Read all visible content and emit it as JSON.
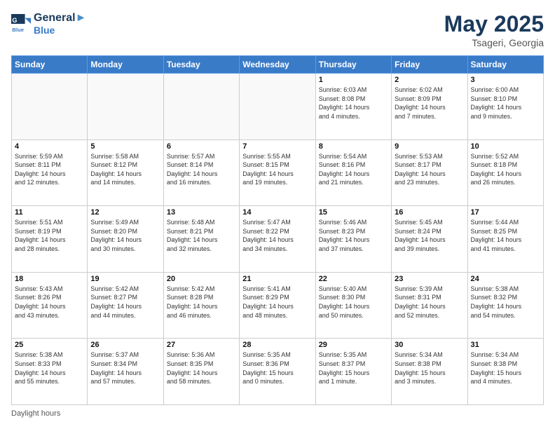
{
  "header": {
    "logo_line1": "General",
    "logo_line2": "Blue",
    "month_title": "May 2025",
    "location": "Tsageri, Georgia"
  },
  "footer": {
    "label": "Daylight hours"
  },
  "days_of_week": [
    "Sunday",
    "Monday",
    "Tuesday",
    "Wednesday",
    "Thursday",
    "Friday",
    "Saturday"
  ],
  "weeks": [
    [
      {
        "num": "",
        "info": ""
      },
      {
        "num": "",
        "info": ""
      },
      {
        "num": "",
        "info": ""
      },
      {
        "num": "",
        "info": ""
      },
      {
        "num": "1",
        "info": "Sunrise: 6:03 AM\nSunset: 8:08 PM\nDaylight: 14 hours\nand 4 minutes."
      },
      {
        "num": "2",
        "info": "Sunrise: 6:02 AM\nSunset: 8:09 PM\nDaylight: 14 hours\nand 7 minutes."
      },
      {
        "num": "3",
        "info": "Sunrise: 6:00 AM\nSunset: 8:10 PM\nDaylight: 14 hours\nand 9 minutes."
      }
    ],
    [
      {
        "num": "4",
        "info": "Sunrise: 5:59 AM\nSunset: 8:11 PM\nDaylight: 14 hours\nand 12 minutes."
      },
      {
        "num": "5",
        "info": "Sunrise: 5:58 AM\nSunset: 8:12 PM\nDaylight: 14 hours\nand 14 minutes."
      },
      {
        "num": "6",
        "info": "Sunrise: 5:57 AM\nSunset: 8:14 PM\nDaylight: 14 hours\nand 16 minutes."
      },
      {
        "num": "7",
        "info": "Sunrise: 5:55 AM\nSunset: 8:15 PM\nDaylight: 14 hours\nand 19 minutes."
      },
      {
        "num": "8",
        "info": "Sunrise: 5:54 AM\nSunset: 8:16 PM\nDaylight: 14 hours\nand 21 minutes."
      },
      {
        "num": "9",
        "info": "Sunrise: 5:53 AM\nSunset: 8:17 PM\nDaylight: 14 hours\nand 23 minutes."
      },
      {
        "num": "10",
        "info": "Sunrise: 5:52 AM\nSunset: 8:18 PM\nDaylight: 14 hours\nand 26 minutes."
      }
    ],
    [
      {
        "num": "11",
        "info": "Sunrise: 5:51 AM\nSunset: 8:19 PM\nDaylight: 14 hours\nand 28 minutes."
      },
      {
        "num": "12",
        "info": "Sunrise: 5:49 AM\nSunset: 8:20 PM\nDaylight: 14 hours\nand 30 minutes."
      },
      {
        "num": "13",
        "info": "Sunrise: 5:48 AM\nSunset: 8:21 PM\nDaylight: 14 hours\nand 32 minutes."
      },
      {
        "num": "14",
        "info": "Sunrise: 5:47 AM\nSunset: 8:22 PM\nDaylight: 14 hours\nand 34 minutes."
      },
      {
        "num": "15",
        "info": "Sunrise: 5:46 AM\nSunset: 8:23 PM\nDaylight: 14 hours\nand 37 minutes."
      },
      {
        "num": "16",
        "info": "Sunrise: 5:45 AM\nSunset: 8:24 PM\nDaylight: 14 hours\nand 39 minutes."
      },
      {
        "num": "17",
        "info": "Sunrise: 5:44 AM\nSunset: 8:25 PM\nDaylight: 14 hours\nand 41 minutes."
      }
    ],
    [
      {
        "num": "18",
        "info": "Sunrise: 5:43 AM\nSunset: 8:26 PM\nDaylight: 14 hours\nand 43 minutes."
      },
      {
        "num": "19",
        "info": "Sunrise: 5:42 AM\nSunset: 8:27 PM\nDaylight: 14 hours\nand 44 minutes."
      },
      {
        "num": "20",
        "info": "Sunrise: 5:42 AM\nSunset: 8:28 PM\nDaylight: 14 hours\nand 46 minutes."
      },
      {
        "num": "21",
        "info": "Sunrise: 5:41 AM\nSunset: 8:29 PM\nDaylight: 14 hours\nand 48 minutes."
      },
      {
        "num": "22",
        "info": "Sunrise: 5:40 AM\nSunset: 8:30 PM\nDaylight: 14 hours\nand 50 minutes."
      },
      {
        "num": "23",
        "info": "Sunrise: 5:39 AM\nSunset: 8:31 PM\nDaylight: 14 hours\nand 52 minutes."
      },
      {
        "num": "24",
        "info": "Sunrise: 5:38 AM\nSunset: 8:32 PM\nDaylight: 14 hours\nand 54 minutes."
      }
    ],
    [
      {
        "num": "25",
        "info": "Sunrise: 5:38 AM\nSunset: 8:33 PM\nDaylight: 14 hours\nand 55 minutes."
      },
      {
        "num": "26",
        "info": "Sunrise: 5:37 AM\nSunset: 8:34 PM\nDaylight: 14 hours\nand 57 minutes."
      },
      {
        "num": "27",
        "info": "Sunrise: 5:36 AM\nSunset: 8:35 PM\nDaylight: 14 hours\nand 58 minutes."
      },
      {
        "num": "28",
        "info": "Sunrise: 5:35 AM\nSunset: 8:36 PM\nDaylight: 15 hours\nand 0 minutes."
      },
      {
        "num": "29",
        "info": "Sunrise: 5:35 AM\nSunset: 8:37 PM\nDaylight: 15 hours\nand 1 minute."
      },
      {
        "num": "30",
        "info": "Sunrise: 5:34 AM\nSunset: 8:38 PM\nDaylight: 15 hours\nand 3 minutes."
      },
      {
        "num": "31",
        "info": "Sunrise: 5:34 AM\nSunset: 8:38 PM\nDaylight: 15 hours\nand 4 minutes."
      }
    ]
  ]
}
